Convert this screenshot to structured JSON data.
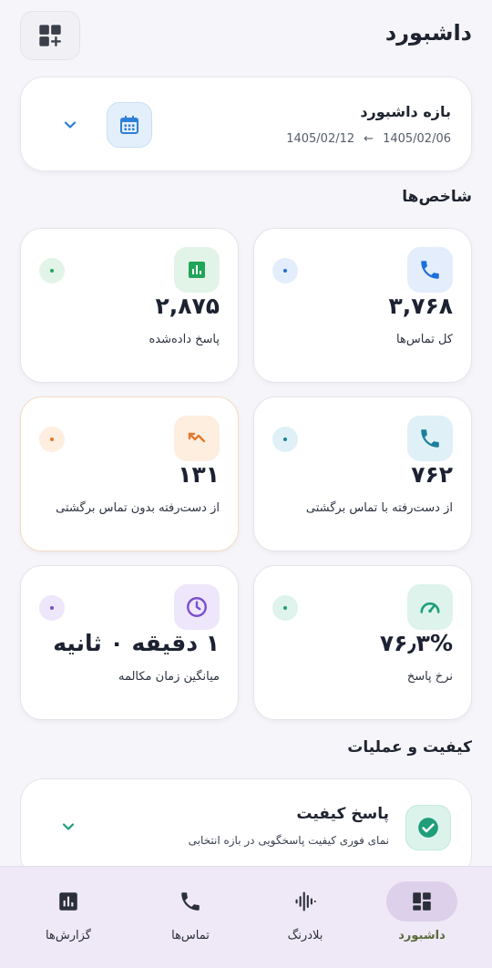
{
  "header": {
    "title": "داشبورد"
  },
  "range": {
    "title": "بازه داشبورد",
    "start_date": "1405/02/06",
    "arrow": "←",
    "end_date": "1405/02/12"
  },
  "kpi_section": {
    "title": "شاخص‌ها",
    "cards": [
      {
        "value": "۳,۷۶۸",
        "label": "کل تماس‌ها",
        "icon": "phone-icon",
        "color": "#1e6fd9",
        "bg": "#e3edfb"
      },
      {
        "value": "۲,۸۷۵",
        "label": "پاسخ داده‌شده",
        "icon": "bar-chart-icon",
        "color": "#22a55a",
        "bg": "#e2f4e8"
      },
      {
        "value": "۷۶۲",
        "label": "از دست‌رفته با تماس برگشتی",
        "icon": "phone-icon",
        "color": "#1c7f9a",
        "bg": "#dff0f6"
      },
      {
        "value": "۱۳۱",
        "label": "از دست‌رفته بدون تماس برگشتی",
        "icon": "missed-call-icon",
        "color": "#e07a2b",
        "bg": "#fdeee0"
      },
      {
        "value": "۷۶٫۳%",
        "label": "نرخ پاسخ",
        "icon": "gauge-icon",
        "color": "#1f9d7a",
        "bg": "#ddf3ec"
      },
      {
        "value": "۱ دقیقه ۰ ثانیه",
        "label": "میانگین زمان مکالمه",
        "icon": "clock-icon",
        "color": "#7a4fcf",
        "bg": "#eee6fa"
      }
    ]
  },
  "quality_section": {
    "title": "کیفیت و عملیات",
    "card_title": "پاسخ کیفیت",
    "card_subtitle": "نمای فوری کیفیت پاسخگویی در بازه انتخابی"
  },
  "bottom_nav": {
    "items": [
      {
        "label": "داشبورد",
        "icon": "dashboard-icon",
        "active": true
      },
      {
        "label": "بلادرنگ",
        "icon": "waveform-icon",
        "active": false
      },
      {
        "label": "تماس‌ها",
        "icon": "phone-icon",
        "active": false
      },
      {
        "label": "گزارش‌ها",
        "icon": "report-icon",
        "active": false
      }
    ]
  }
}
